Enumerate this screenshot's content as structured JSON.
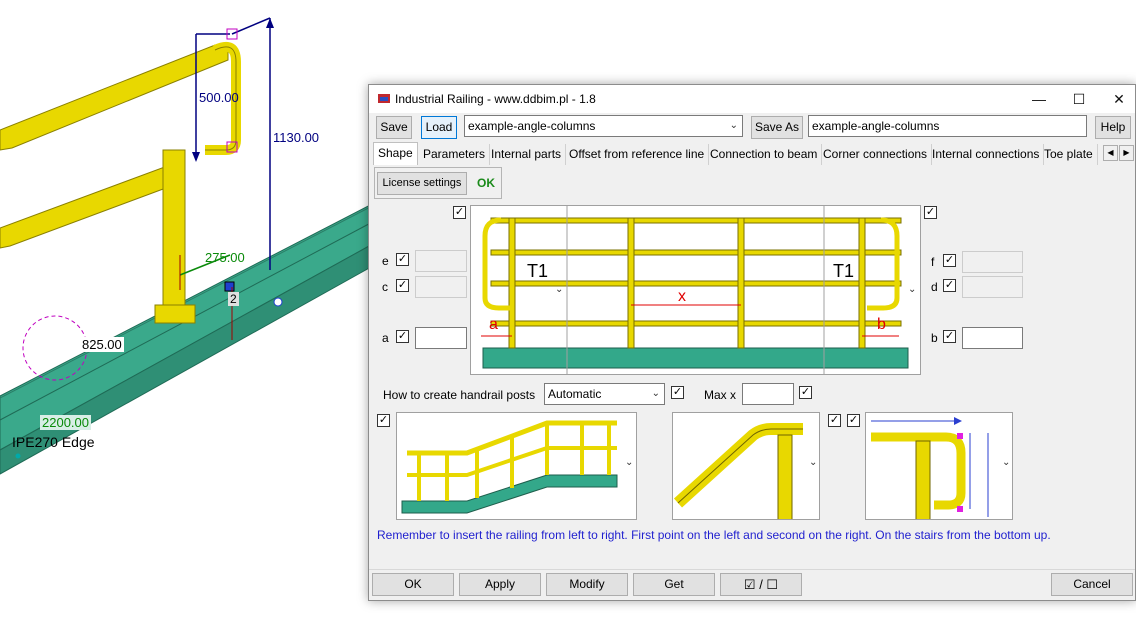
{
  "viewport": {
    "dimensions": [
      "500.00",
      "1130.00",
      "275.00",
      "825.00",
      "2200.00"
    ],
    "point_label": "2",
    "edge_label": "IPE270 Edge"
  },
  "dialog": {
    "title": "Industrial Railing - www.ddbim.pl - 1.8",
    "toolbar": {
      "save_label": "Save",
      "load_label": "Load",
      "preset_value": "example-angle-columns",
      "save_as_label": "Save As",
      "save_as_value": "example-angle-columns",
      "help_label": "Help"
    },
    "tabs": [
      "Shape",
      "Parameters",
      "Internal parts",
      "Offset from reference line",
      "Connection to beam",
      "Corner connections",
      "Internal connections",
      "Toe plate"
    ],
    "license": {
      "button": "License settings",
      "status": "OK"
    },
    "fields": {
      "e": "e",
      "c": "c",
      "a": "a",
      "f": "f",
      "d": "d",
      "b": "b"
    },
    "images": {
      "left_profile": "T1",
      "right_profile": "T1",
      "dim_a": "a",
      "dim_x": "x",
      "dim_b": "b"
    },
    "handrail_posts": {
      "label": "How to create handrail posts",
      "value": "Automatic",
      "max_x_label": "Max x",
      "max_x_value": ""
    },
    "note": "Remember to insert the railing from left to right. First point on the left and second on the right. On the stairs from the bottom up.",
    "buttons": {
      "ok": "OK",
      "apply": "Apply",
      "modify": "Modify",
      "get": "Get",
      "toggle": "☑ / ☐",
      "cancel": "Cancel"
    },
    "colors": {
      "railing": "#e8d800",
      "beam": "#33a88a",
      "note": "#1f1fcf",
      "ok_status": "#1a8a1a"
    }
  }
}
